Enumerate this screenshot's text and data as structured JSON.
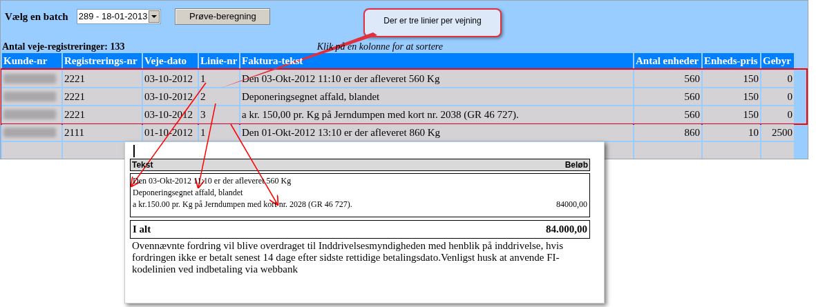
{
  "batch_label": "Vælg en batch",
  "batch_select": {
    "value": "289 - 18-01-2013"
  },
  "buttons": [
    "Prøve-beregning"
  ],
  "count_label": "Antal veje-registreringer: 133",
  "sort_hint": "Klik på en kolonne for at sortere",
  "table": {
    "columns": [
      "Kunde-nr",
      "Registrerings-nr",
      "Veje-dato",
      "Linie-nr",
      "Faktura-tekst",
      "Antal enheder",
      "Enheds-pris",
      "Gebyr"
    ],
    "rows": [
      {
        "highlighted": true,
        "kunde_blurred": true,
        "cells": [
          "",
          "2221",
          "03-10-2012",
          "1",
          "Den 03-Okt-2012 11:10 er der afleveret 560 Kg",
          "560",
          "150",
          "0"
        ]
      },
      {
        "highlighted": true,
        "kunde_blurred": true,
        "cells": [
          "",
          "2221",
          "03-10-2012",
          "2",
          "Deponeringsegnet affald, blandet",
          "560",
          "150",
          "0"
        ]
      },
      {
        "highlighted": true,
        "kunde_blurred": true,
        "cells": [
          "",
          "2221",
          "03-10-2012",
          "3",
          "a kr. 150,00 pr. Kg på Jerndumpen med kort nr. 2038 (GR 46 727).",
          "560",
          "150",
          "0"
        ]
      },
      {
        "highlighted": false,
        "kunde_blurred": true,
        "cells": [
          "",
          "2111",
          "01-10-2012",
          "1",
          "Den 01-Okt-2012 13:10 er der afleveret 860 Kg",
          "860",
          "10",
          "2500"
        ]
      }
    ]
  },
  "callout": {
    "text": "Der er tre linier per vejning"
  },
  "invoice": {
    "columns": [
      "Tekst",
      "Beløb"
    ],
    "lines": [
      "Den 03-Okt-2012 11:10 er der afleveret 560 Kg",
      "Deponeringsegnet affald, blandet",
      "a kr.150.00 pr. Kg på Jerndumpen med kort nr. 2028 (GR 46 727)."
    ],
    "amount": "84000,00",
    "total_label": "I alt",
    "total": "84.000,00",
    "note": "Ovennævnte fordring vil blive overdraget til Inddrivelsesmyndigheden med henblik på inddrivelse, hvis fordringen ikke er betalt senest 14 dage efter sidste rettidige betalingsdato.Venligst husk at anvende FI-kodelinien ved indbetaling via webbank"
  }
}
